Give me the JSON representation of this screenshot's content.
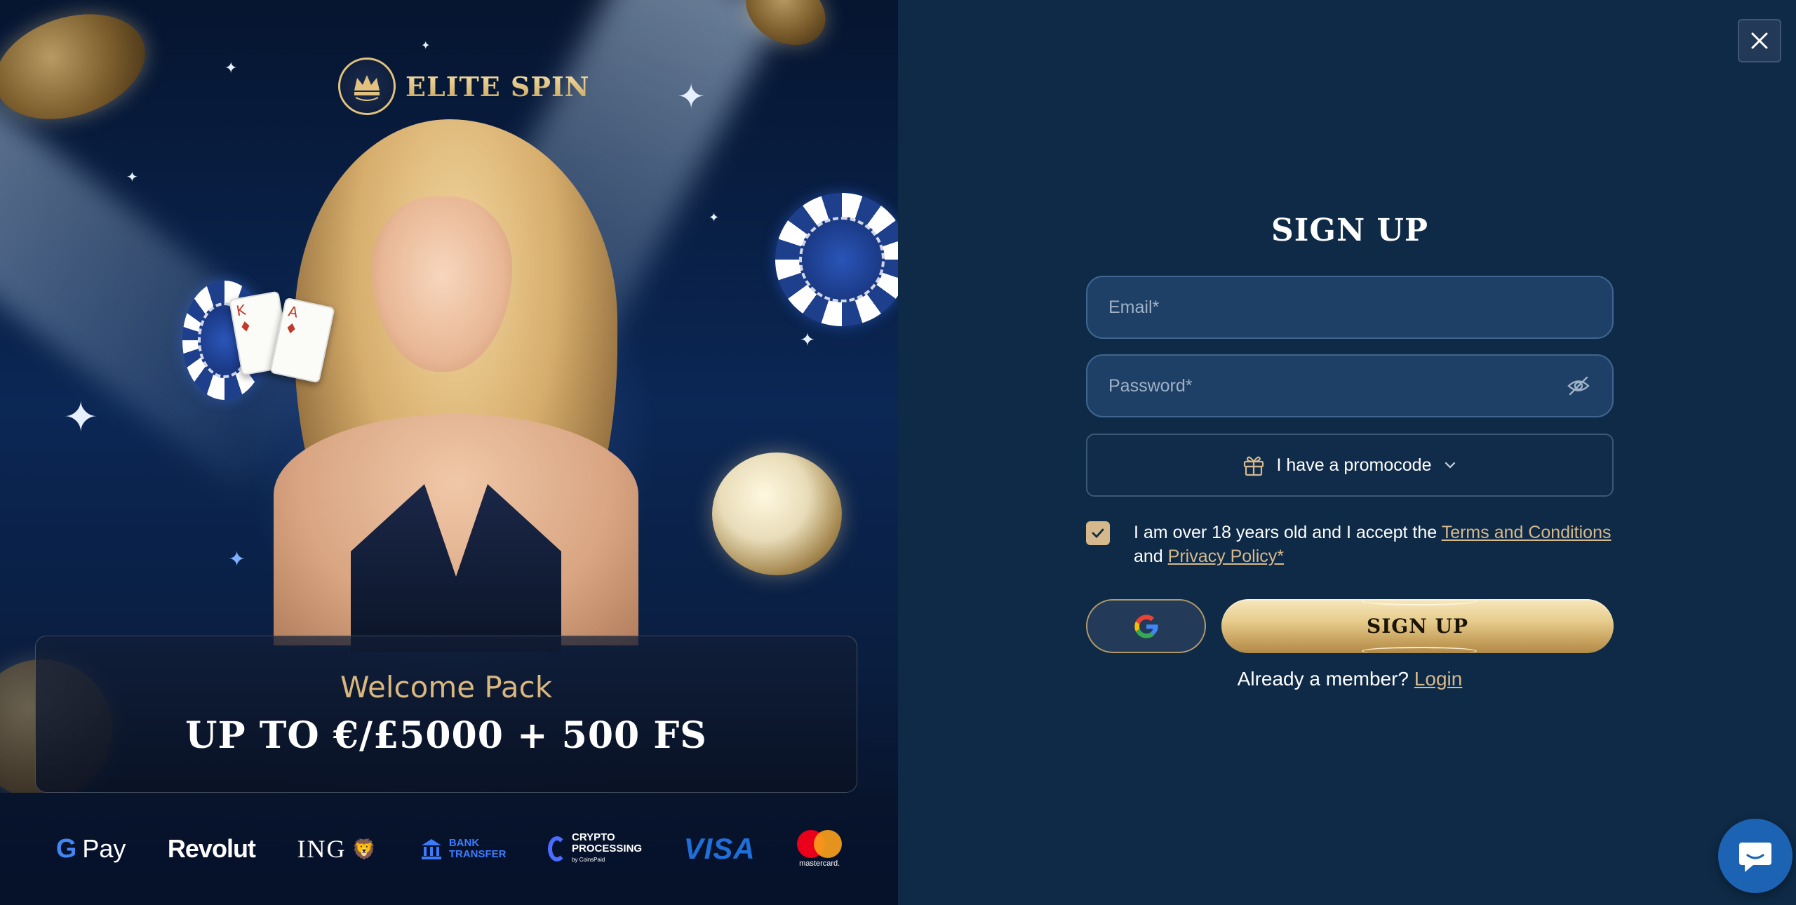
{
  "brand": {
    "name": "ELITE SPIN"
  },
  "promo": {
    "title": "Welcome Pack",
    "offer": "UP TO €/£5000 + 500 FS"
  },
  "payments": {
    "gpay": {
      "g": "G",
      "text": "Pay"
    },
    "revolut": "Revolut",
    "ing": "ING",
    "bank_transfer": [
      "BANK",
      "TRANSFER"
    ],
    "crypto": [
      "CRYPTO",
      "PROCESSING",
      "by CoinsPaid"
    ],
    "visa": "VISA",
    "mastercard": "mastercard."
  },
  "signup": {
    "title": "SIGN UP",
    "email_placeholder": "Email*",
    "password_placeholder": "Password*",
    "promocode_label": "I have a promocode",
    "consent": {
      "checked": true,
      "text_before": "I am over 18 years old and I accept the ",
      "terms_link": "Terms and Conditions",
      "text_middle": " and ",
      "privacy_link": "Privacy Policy*"
    },
    "submit_label": "SIGN UP",
    "member_text": "Already a member?",
    "login_link": "Login"
  },
  "colors": {
    "panel_bg": "#0e2a46",
    "field_bg": "#1e4066",
    "gold_accent": "#d5b98d",
    "chat_blue": "#1d63b4"
  },
  "icons": [
    "close-icon",
    "eye-off-icon",
    "gift-icon",
    "chevron-down-icon",
    "check-icon",
    "google-icon",
    "chat-icon",
    "crown-icon"
  ]
}
